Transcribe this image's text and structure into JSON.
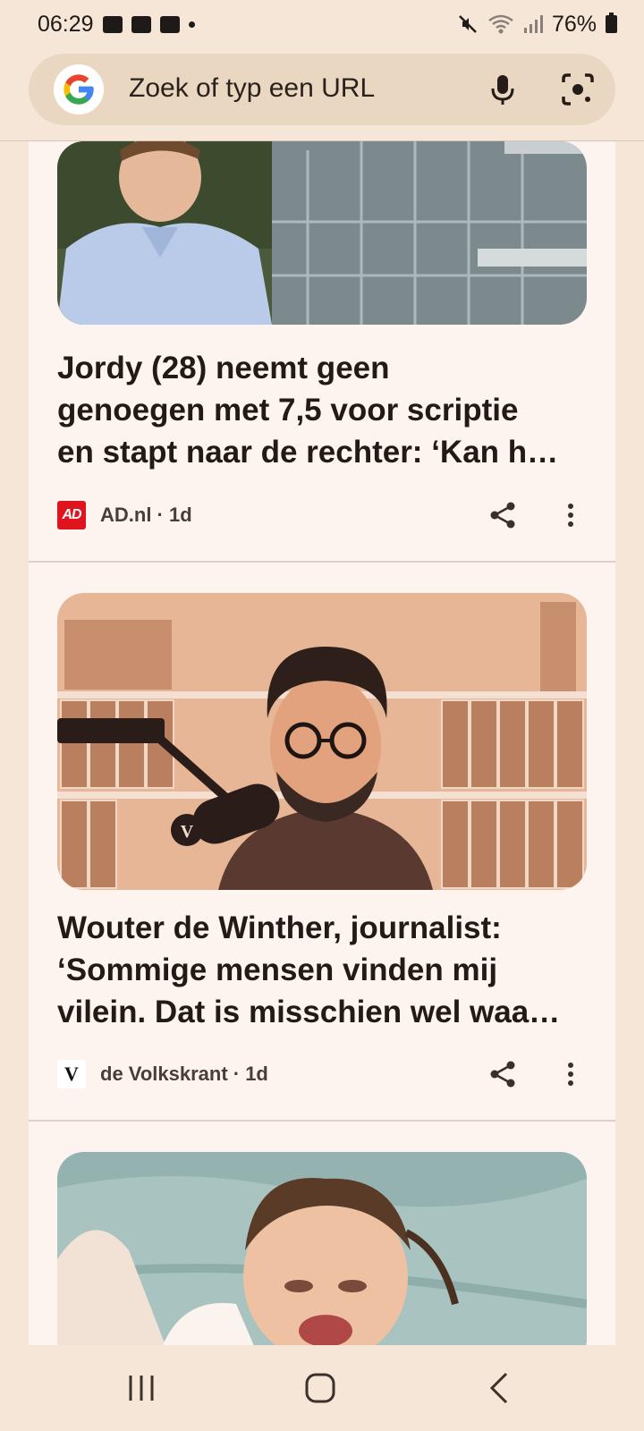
{
  "status_bar": {
    "time": "06:29",
    "battery": "76%",
    "icons": [
      "gallery-icon",
      "mail-icon",
      "mail-icon",
      "dot-icon",
      "mute-icon",
      "wifi-icon",
      "signal-icon",
      "battery-icon"
    ]
  },
  "search": {
    "placeholder": "Zoek of typ een URL",
    "logo": "G",
    "brand_colors": {
      "blue": "#4285F4",
      "red": "#EA4335",
      "yellow": "#FBBC05",
      "green": "#34A853"
    }
  },
  "cards": [
    {
      "headline_lines": [
        "Jordy (28) neemt geen",
        "genoegen met 7,5 voor scriptie",
        "en stapt naar de rechter: ‘Kan h…"
      ],
      "source_logo": "AD",
      "source": "AD.nl · 1d"
    },
    {
      "headline_lines": [
        "Wouter de Winther, journalist:",
        "‘Sommige mensen vinden mij",
        "vilein. Dat is misschien wel waa…"
      ],
      "source_logo": "V",
      "source": "de Volkskrant · 1d",
      "image_badge": "V"
    }
  ],
  "colors": {
    "background": "#f5e6d7",
    "card": "#fdf4f0",
    "search_bar": "#ead7c1",
    "ad_red": "#e0141e"
  }
}
